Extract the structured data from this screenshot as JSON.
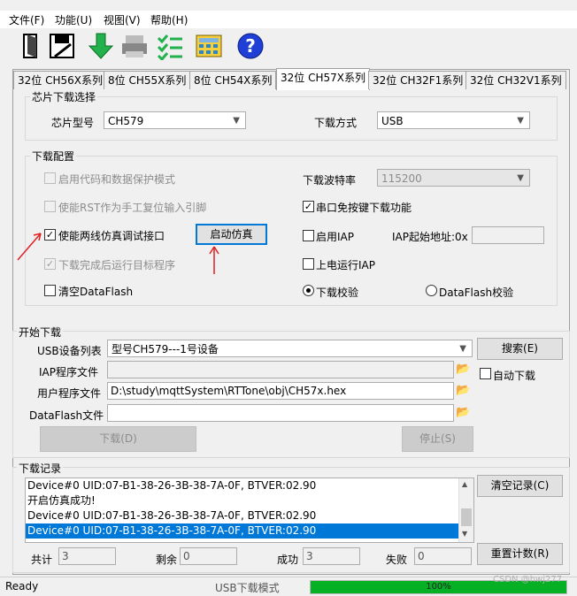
{
  "menu": [
    "文件(F)",
    "功能(U)",
    "视图(V)",
    "帮助(H)"
  ],
  "toolbar": {
    "icons": [
      "open-file-icon",
      "save-icon",
      "download-arrow-icon",
      "printer-icon",
      "checklist-icon",
      "calculator-icon",
      "help-icon"
    ],
    "help_glyph": "?"
  },
  "tabs": [
    "32位 CH56X系列",
    "8位 CH55X系列",
    "8位 CH54X系列",
    "32位 CH57X系列",
    "32位 CH32F1系列",
    "32位 CH32V1系列"
  ],
  "active_tab": 3,
  "chip_select": {
    "title": "芯片下载选择",
    "chip_label": "芯片型号",
    "chip_value": "CH579",
    "mode_label": "下载方式",
    "mode_value": "USB"
  },
  "config": {
    "title": "下载配置",
    "code_protect": "启用代码和数据保护模式",
    "rst_pin": "使能RST作为手工复位输入引脚",
    "swd": "使能两线仿真调试接口",
    "run_after": "下载完成后运行目标程序",
    "clear_dataflash": "清空DataFlash",
    "start_emu": "启动仿真",
    "baud_label": "下载波特率",
    "baud_value": "115200",
    "serial_nokey": "串口免按键下载功能",
    "enable_iap": "启用IAP",
    "iap_addr_label": "IAP起始地址:0x",
    "iap_addr_value": "",
    "power_run": "上电运行IAP",
    "verify": "下载校验",
    "dataflash_verify": "DataFlash校验"
  },
  "start": {
    "title": "开始下载",
    "usb_label": "USB设备列表",
    "usb_value": "型号CH579---1号设备",
    "search": "搜索(E)",
    "iap_label": "IAP程序文件",
    "iap_value": "",
    "auto_download": "自动下载",
    "user_label": "用户程序文件",
    "user_value": "D:\\study\\mqttSystem\\RTTone\\obj\\CH57x.hex",
    "df_label": "DataFlash文件",
    "df_value": "",
    "download": "下载(D)",
    "stop": "停止(S)"
  },
  "log": {
    "title": "下载记录",
    "rows": [
      "Device#0  UID:07-B1-38-26-3B-38-7A-0F, BTVER:02.90",
      "开启仿真成功!",
      "Device#0  UID:07-B1-38-26-3B-38-7A-0F, BTVER:02.90",
      "Device#0  UID:07-B1-38-26-3B-38-7A-0F, BTVER:02.90"
    ],
    "selected_row": 3,
    "clear": "清空记录(C)",
    "reset": "重置计数(R)"
  },
  "counts": {
    "total_label": "共计",
    "total": "3",
    "remain_label": "剩余",
    "remain": "0",
    "success_label": "成功",
    "success": "3",
    "fail_label": "失败",
    "fail": "0"
  },
  "status": {
    "ready": "Ready",
    "mode": "USB下载模式",
    "progress_text": "100%",
    "progress": 1.0,
    "watermark": "CSDN @hwj277"
  },
  "colors": {
    "accent": "#0078d7",
    "progress": "#06b025",
    "annotation": "#e02020"
  }
}
